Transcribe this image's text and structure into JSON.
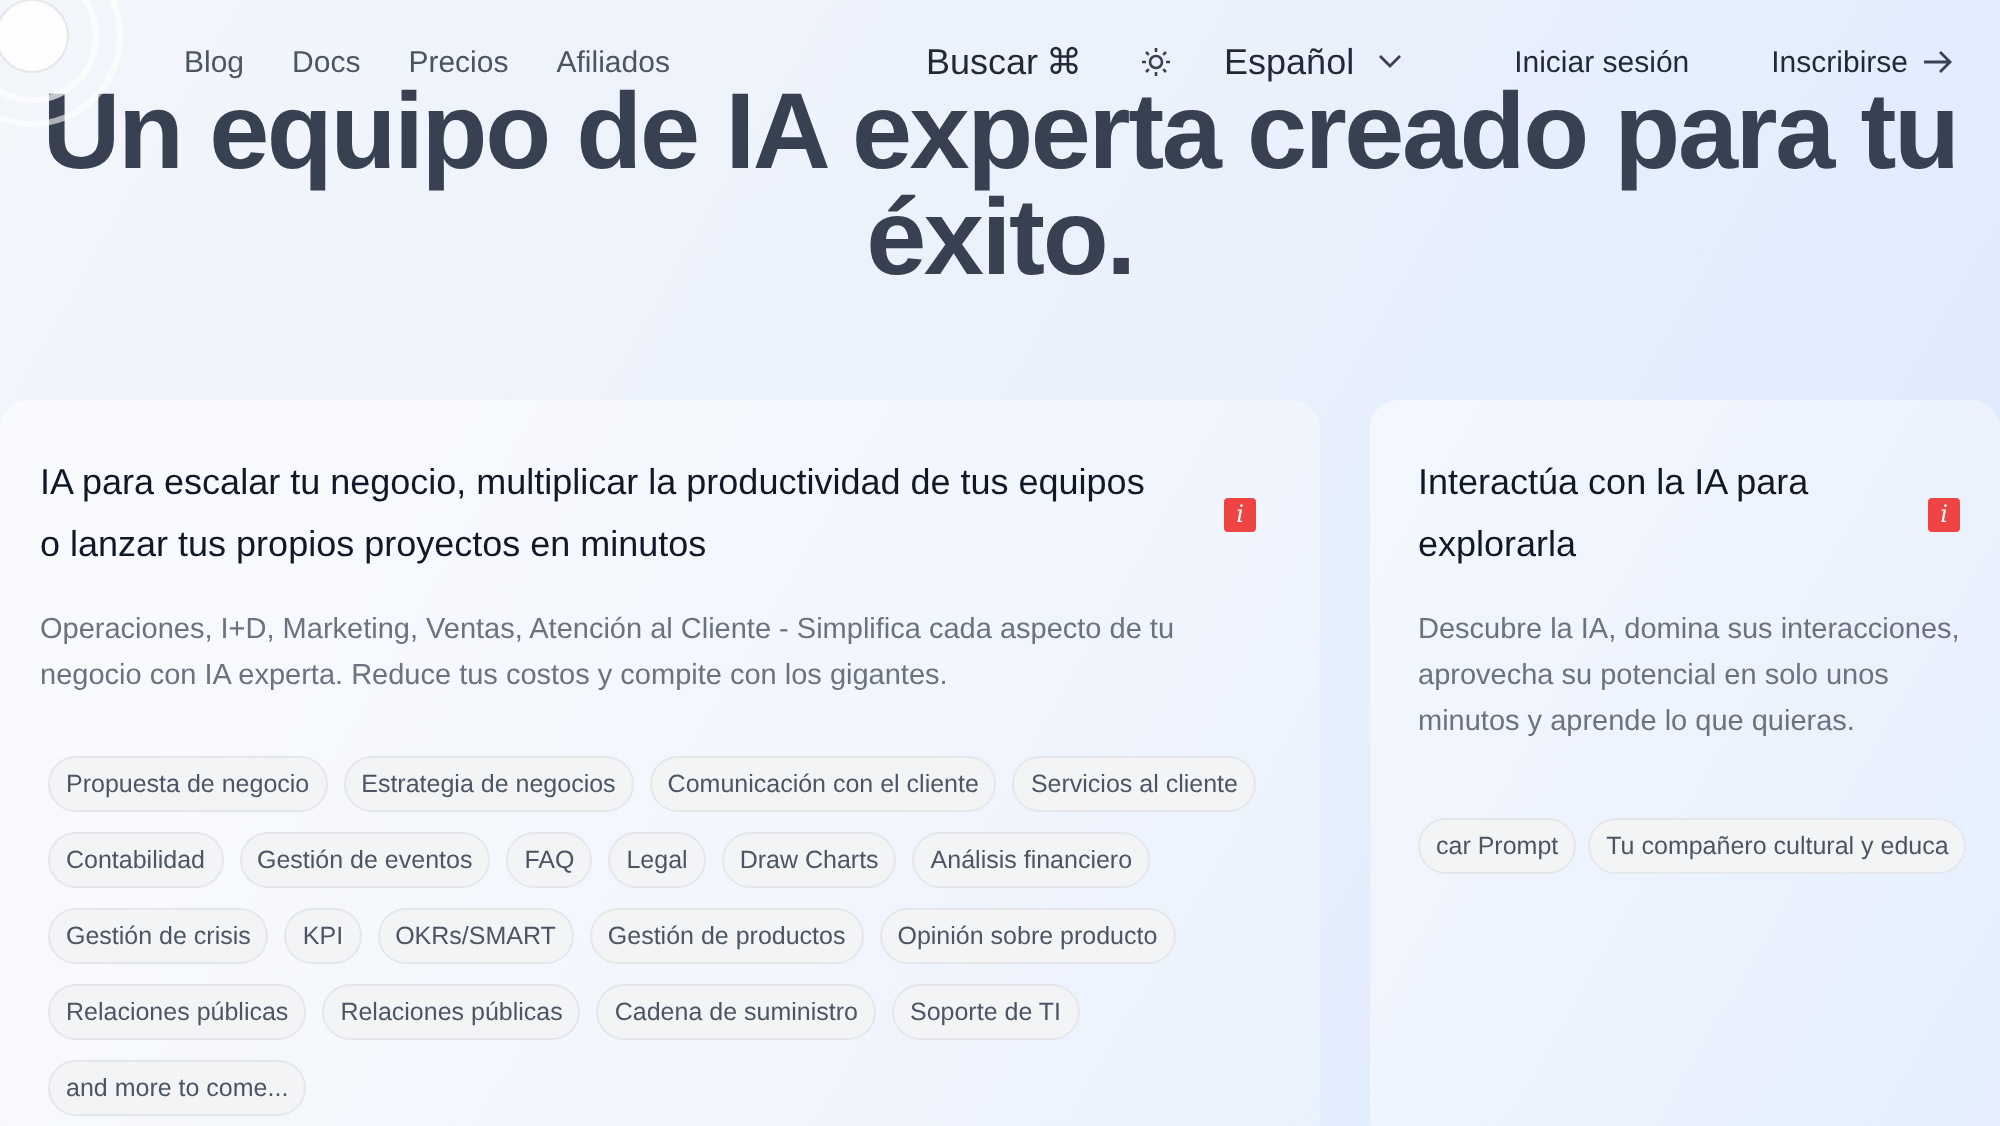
{
  "nav": {
    "links": [
      "Blog",
      "Docs",
      "Precios",
      "Afiliados"
    ],
    "search": {
      "label": "Buscar",
      "shortcut": "⌘"
    },
    "language": "Español",
    "login": "Iniciar sesión",
    "signup": "Inscribirse"
  },
  "headline": "Un equipo de IA experta creado para tu éxito.",
  "cards": [
    {
      "title": "IA para escalar tu negocio, multiplicar la productividad de tus equipos o lanzar tus propios proyectos en minutos",
      "badge": "i",
      "description": "Operaciones, I+D, Marketing, Ventas, Atención al Cliente - Simplifica cada aspecto de tu negocio con IA experta. Reduce tus costos y compite con los gigantes.",
      "tags": [
        "Propuesta de negocio",
        "Estrategia de negocios",
        "Comunicación con el cliente",
        "Servicios al cliente",
        "Contabilidad",
        "Gestión de eventos",
        "FAQ",
        "Legal",
        "Draw Charts",
        "Análisis financiero",
        "Gestión de crisis",
        "KPI",
        "OKRs/SMART",
        "Gestión de productos",
        "Opinión sobre producto",
        "Relaciones públicas",
        "Relaciones públicas",
        "Cadena de suministro",
        "Soporte de TI",
        "and more to come..."
      ]
    },
    {
      "title": "Interactúa con la IA para explorarla",
      "badge": "i",
      "description": "Descubre la IA, domina sus interacciones, aprovecha su potencial en solo unos minutos y aprende lo que quieras.",
      "tags": [
        "car Prompt",
        "Tu compañero cultural y educa"
      ]
    }
  ]
}
